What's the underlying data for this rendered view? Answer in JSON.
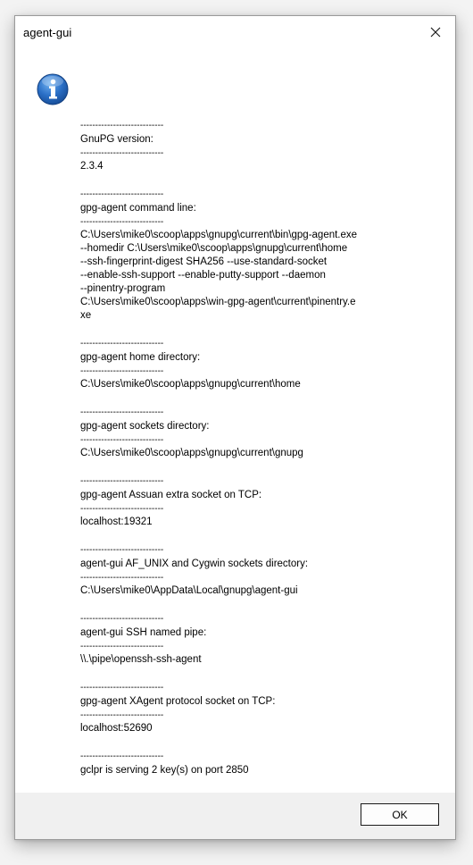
{
  "window": {
    "title": "agent-gui"
  },
  "icons": {
    "close": "close-icon",
    "info": "info-icon",
    "info_color": "#1e5fb4"
  },
  "message": {
    "separator": "----------------------------",
    "sections": [
      {
        "header": "GnuPG version:",
        "value": "2.3.4"
      },
      {
        "header": "gpg-agent command line:",
        "value": "C:\\Users\\mike0\\scoop\\apps\\gnupg\\current\\bin\\gpg-agent.exe\n--homedir C:\\Users\\mike0\\scoop\\apps\\gnupg\\current\\home\n--ssh-fingerprint-digest SHA256 --use-standard-socket\n--enable-ssh-support --enable-putty-support --daemon\n--pinentry-program\nC:\\Users\\mike0\\scoop\\apps\\win-gpg-agent\\current\\pinentry.e\nxe"
      },
      {
        "header": "gpg-agent home directory:",
        "value": "C:\\Users\\mike0\\scoop\\apps\\gnupg\\current\\home"
      },
      {
        "header": "gpg-agent sockets directory:",
        "value": "C:\\Users\\mike0\\scoop\\apps\\gnupg\\current\\gnupg"
      },
      {
        "header": "gpg-agent Assuan extra socket on TCP:",
        "value": "localhost:19321"
      },
      {
        "header": "agent-gui AF_UNIX and Cygwin sockets directory:",
        "value": "C:\\Users\\mike0\\AppData\\Local\\gnupg\\agent-gui"
      },
      {
        "header": "agent-gui SSH named pipe:",
        "value": "\\\\.\\pipe\\openssh-ssh-agent"
      },
      {
        "header": "gpg-agent XAgent protocol socket on TCP:",
        "value": "localhost:52690"
      }
    ],
    "final_line": "gclpr is serving 2 key(s) on port 2850"
  },
  "buttons": {
    "ok_label": "OK"
  }
}
